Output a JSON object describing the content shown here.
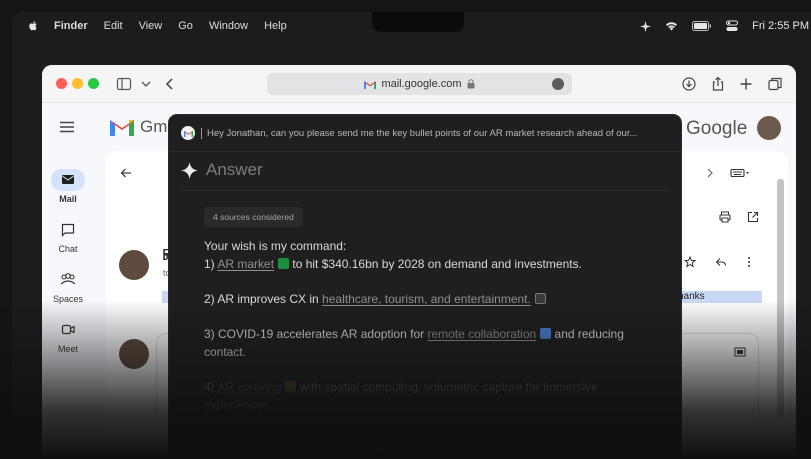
{
  "menubar": {
    "items": [
      "Finder",
      "Edit",
      "View",
      "Go",
      "Window",
      "Help"
    ],
    "clock": "Fri 2:55 PM"
  },
  "browser": {
    "url": "mail.google.com"
  },
  "gmail": {
    "logo_text": "Gm",
    "google_word": "Google",
    "rail": [
      {
        "label": "Mail",
        "icon": "mail-icon"
      },
      {
        "label": "Chat",
        "icon": "chat-icon"
      },
      {
        "label": "Spaces",
        "icon": "spaces-icon"
      },
      {
        "label": "Meet",
        "icon": "meet-icon"
      }
    ],
    "subject_initial": "F",
    "sender_initial": "J",
    "sender_to": "to",
    "highlight_tail": "hanks"
  },
  "assistant": {
    "query": "Hey Jonathan, can you please send me the key bullet points of our AR market research ahead of our...",
    "answer_title": "Answer",
    "sources_label": "4 sources considered",
    "intro": "Your wish is my command:",
    "points": [
      {
        "prefix": "1) ",
        "link": "AR market",
        "chip": "sheet",
        "rest": " to hit $340.16bn by 2028 on demand and investments."
      },
      {
        "prefix": "2) AR improves CX in ",
        "link": "healthcare, tourism, and entertainment.",
        "chip": "notion",
        "rest": ""
      },
      {
        "prefix": "3) COVID-19 accelerates AR adoption for ",
        "link": "remote collaboration",
        "chip": "doc",
        "rest": " and reducing contact."
      },
      {
        "prefix": "4) ",
        "link": "AR evolving",
        "chip": "slide",
        "rest": " with spatial computing, volumetric capture for immersive experiences."
      }
    ]
  },
  "colors": {
    "panel_bg": "#1f1f20",
    "gmail_bg": "#f6f8fc",
    "accent_blue": "#d3e3fd"
  }
}
